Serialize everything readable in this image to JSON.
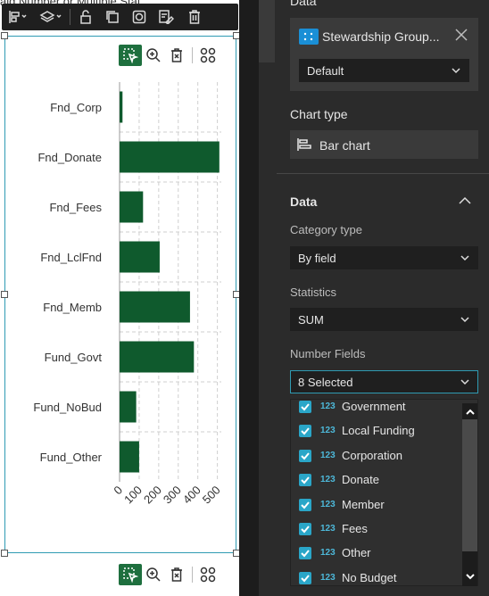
{
  "partial_header": "aid Number or Multiple Stat",
  "toolbar": {
    "align_icon": "align-left-icon",
    "layers_icon": "layers-icon",
    "lock_icon": "lock-icon",
    "duplicate_icon": "duplicate-icon",
    "focus_icon": "focus-icon",
    "edit_icon": "edit-icon",
    "delete_icon": "trash-icon"
  },
  "mini_toolbar": {
    "select_icon": "select-pointer-icon",
    "zoom_icon": "zoom-in-icon",
    "clear_icon": "trash-icon",
    "more_icon": "grid-icon"
  },
  "chart_data": {
    "type": "bar",
    "orientation": "horizontal",
    "categories": [
      "Fnd_Corp",
      "Fnd_Donate",
      "Fnd_Fees",
      "Fnd_LclFnd",
      "Fnd_Memb",
      "Fund_Govt",
      "Fund_NoBud",
      "Fund_Other"
    ],
    "values": [
      15,
      510,
      120,
      205,
      360,
      380,
      85,
      100
    ],
    "xticks": [
      "0",
      "100",
      "200",
      "300",
      "400",
      "500"
    ],
    "xlim": [
      0,
      520
    ],
    "grid": true,
    "bar_color": "#0f5a2d"
  },
  "panel": {
    "data_heading": "Data",
    "layer_name": "Stewardship Group...",
    "view_select": "Default",
    "chart_type_heading": "Chart type",
    "chart_type_value": "Bar chart",
    "data_section": "Data",
    "category_type_label": "Category type",
    "category_type_value": "By field",
    "statistics_label": "Statistics",
    "statistics_value": "SUM",
    "number_fields_label": "Number Fields",
    "number_fields_value": "8 Selected",
    "field_type_badge": "123",
    "fields": [
      {
        "label": "Government"
      },
      {
        "label": "Local Funding"
      },
      {
        "label": "Corporation"
      },
      {
        "label": "Donate"
      },
      {
        "label": "Member"
      },
      {
        "label": "Fees"
      },
      {
        "label": "Other"
      },
      {
        "label": "No Budget"
      }
    ]
  }
}
